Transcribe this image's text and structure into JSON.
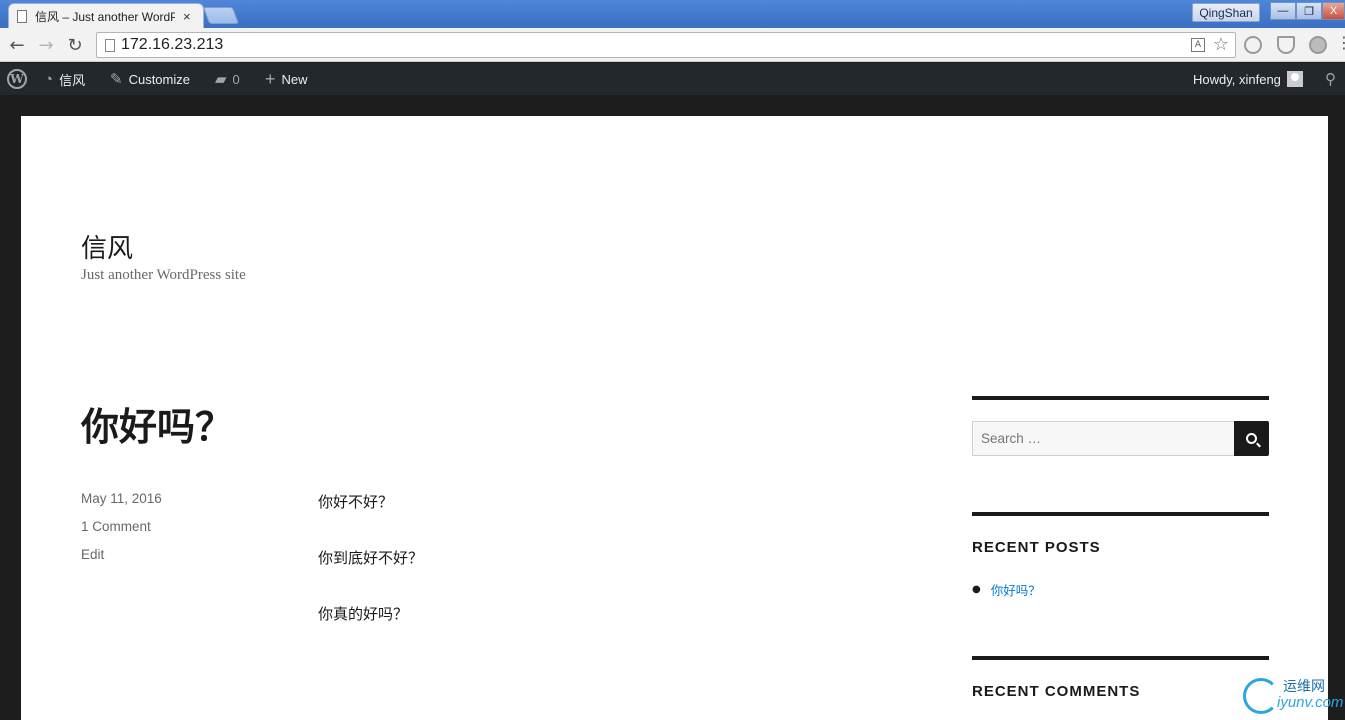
{
  "browser": {
    "tab_title": "信风 – Just another WordPress site",
    "tab_close": "×",
    "profile_name": "QingShan",
    "window_buttons": [
      "—",
      "❐",
      "X"
    ],
    "url": "172.16.23.213"
  },
  "adminbar": {
    "site_name": "信风",
    "customize": "Customize",
    "comments_count": "0",
    "new": "New",
    "howdy": "Howdy, xinfeng"
  },
  "site": {
    "title": "信风",
    "description": "Just another WordPress site"
  },
  "post": {
    "title": "你好吗？",
    "date": "May 11, 2016",
    "comments": "1 Comment",
    "edit": "Edit",
    "paragraphs": [
      "你好不好？",
      "你到底好不好？",
      "你真的好吗？"
    ]
  },
  "sidebar": {
    "search_placeholder": "Search …",
    "recent_posts_title": "RECENT POSTS",
    "recent_posts": [
      "你好吗？"
    ],
    "recent_comments_title": "RECENT COMMENTS"
  },
  "watermark": {
    "line1": "运维网",
    "line2": "iyunv.com"
  },
  "colors": {
    "admin_bar": "#23282d",
    "link": "#007acc",
    "text": "#1a1a1a"
  }
}
